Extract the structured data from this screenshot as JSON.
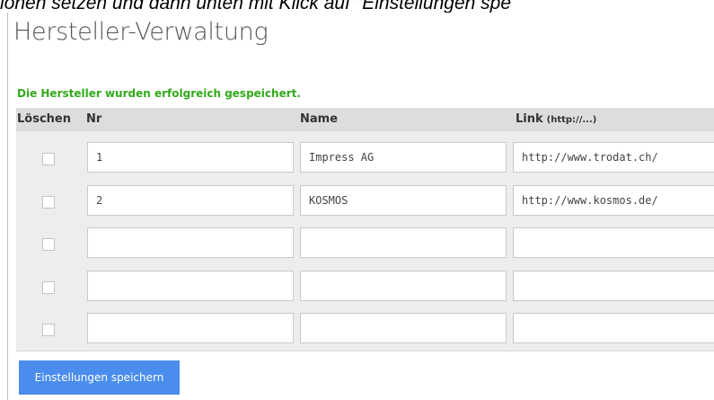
{
  "caption": "iönen setzen und dann unten mit Klick auf \"Einstellungen spe",
  "page": {
    "title": "Hersteller-Verwaltung",
    "success_message": "Die Hersteller wurden erfolgreich gespeichert."
  },
  "table": {
    "headers": {
      "delete": "Löschen",
      "nr": "Nr",
      "name": "Name",
      "link": "Link",
      "link_hint": "(http://...)"
    },
    "rows": [
      {
        "delete_checked": false,
        "nr": "1",
        "name": "Impress AG",
        "link": "http://www.trodat.ch/"
      },
      {
        "delete_checked": false,
        "nr": "2",
        "name": "KOSMOS",
        "link": "http://www.kosmos.de/"
      },
      {
        "delete_checked": false,
        "nr": "",
        "name": "",
        "link": ""
      },
      {
        "delete_checked": false,
        "nr": "",
        "name": "",
        "link": ""
      },
      {
        "delete_checked": false,
        "nr": "",
        "name": "",
        "link": ""
      }
    ]
  },
  "buttons": {
    "save_label": "Einstellungen speichern"
  },
  "colors": {
    "success": "#33aa1c",
    "button": "#4b8ded",
    "header_bg": "#dddddd",
    "table_bg": "#ededed"
  }
}
